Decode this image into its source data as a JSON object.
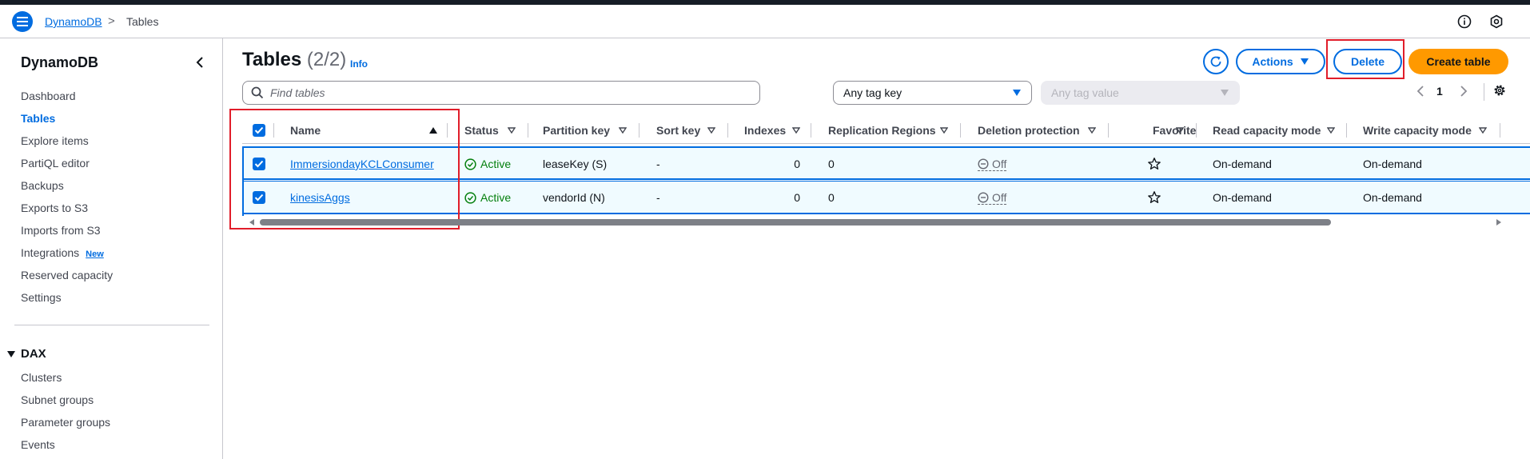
{
  "header": {
    "breadcrumb_root": "DynamoDB",
    "breadcrumb_sep": ">",
    "breadcrumb_current": "Tables"
  },
  "sidebar": {
    "title": "DynamoDB",
    "items": [
      {
        "label": "Dashboard"
      },
      {
        "label": "Tables",
        "active": true
      },
      {
        "label": "Explore items"
      },
      {
        "label": "PartiQL editor"
      },
      {
        "label": "Backups"
      },
      {
        "label": "Exports to S3"
      },
      {
        "label": "Imports from S3"
      },
      {
        "label": "Integrations",
        "badge": "New"
      },
      {
        "label": "Reserved capacity"
      },
      {
        "label": "Settings"
      }
    ],
    "dax_section": {
      "title": "DAX",
      "items": [
        {
          "label": "Clusters"
        },
        {
          "label": "Subnet groups"
        },
        {
          "label": "Parameter groups"
        },
        {
          "label": "Events"
        }
      ]
    }
  },
  "main": {
    "title": "Tables",
    "count": "(2/2)",
    "info_label": "Info",
    "buttons": {
      "actions": "Actions",
      "delete": "Delete",
      "create": "Create table"
    },
    "search": {
      "placeholder": "Find tables",
      "value": ""
    },
    "tag_key_select": {
      "value": "Any tag key"
    },
    "tag_value_select": {
      "value": "Any tag value"
    },
    "pagination": {
      "current_page": "1"
    }
  },
  "table": {
    "columns": [
      "Name",
      "Status",
      "Partition key",
      "Sort key",
      "Indexes",
      "Replication Regions",
      "Deletion protection",
      "Favorite",
      "Read capacity mode",
      "Write capacity mode"
    ],
    "rows": [
      {
        "selected": true,
        "name": "ImmersiondayKCLConsumer",
        "status": "Active",
        "partition_key": "leaseKey (S)",
        "sort_key": "-",
        "indexes": "0",
        "replication_regions": "0",
        "deletion_protection": "Off",
        "read_capacity_mode": "On-demand",
        "write_capacity_mode": "On-demand"
      },
      {
        "selected": true,
        "name": "kinesisAggs",
        "status": "Active",
        "partition_key": "vendorId (N)",
        "sort_key": "-",
        "indexes": "0",
        "replication_regions": "0",
        "deletion_protection": "Off",
        "read_capacity_mode": "On-demand",
        "write_capacity_mode": "On-demand"
      }
    ]
  },
  "colors": {
    "accent": "#006ce0",
    "primary_button": "#ff9900",
    "active_status": "#037f0c",
    "highlight_box": "#e11d2a"
  }
}
